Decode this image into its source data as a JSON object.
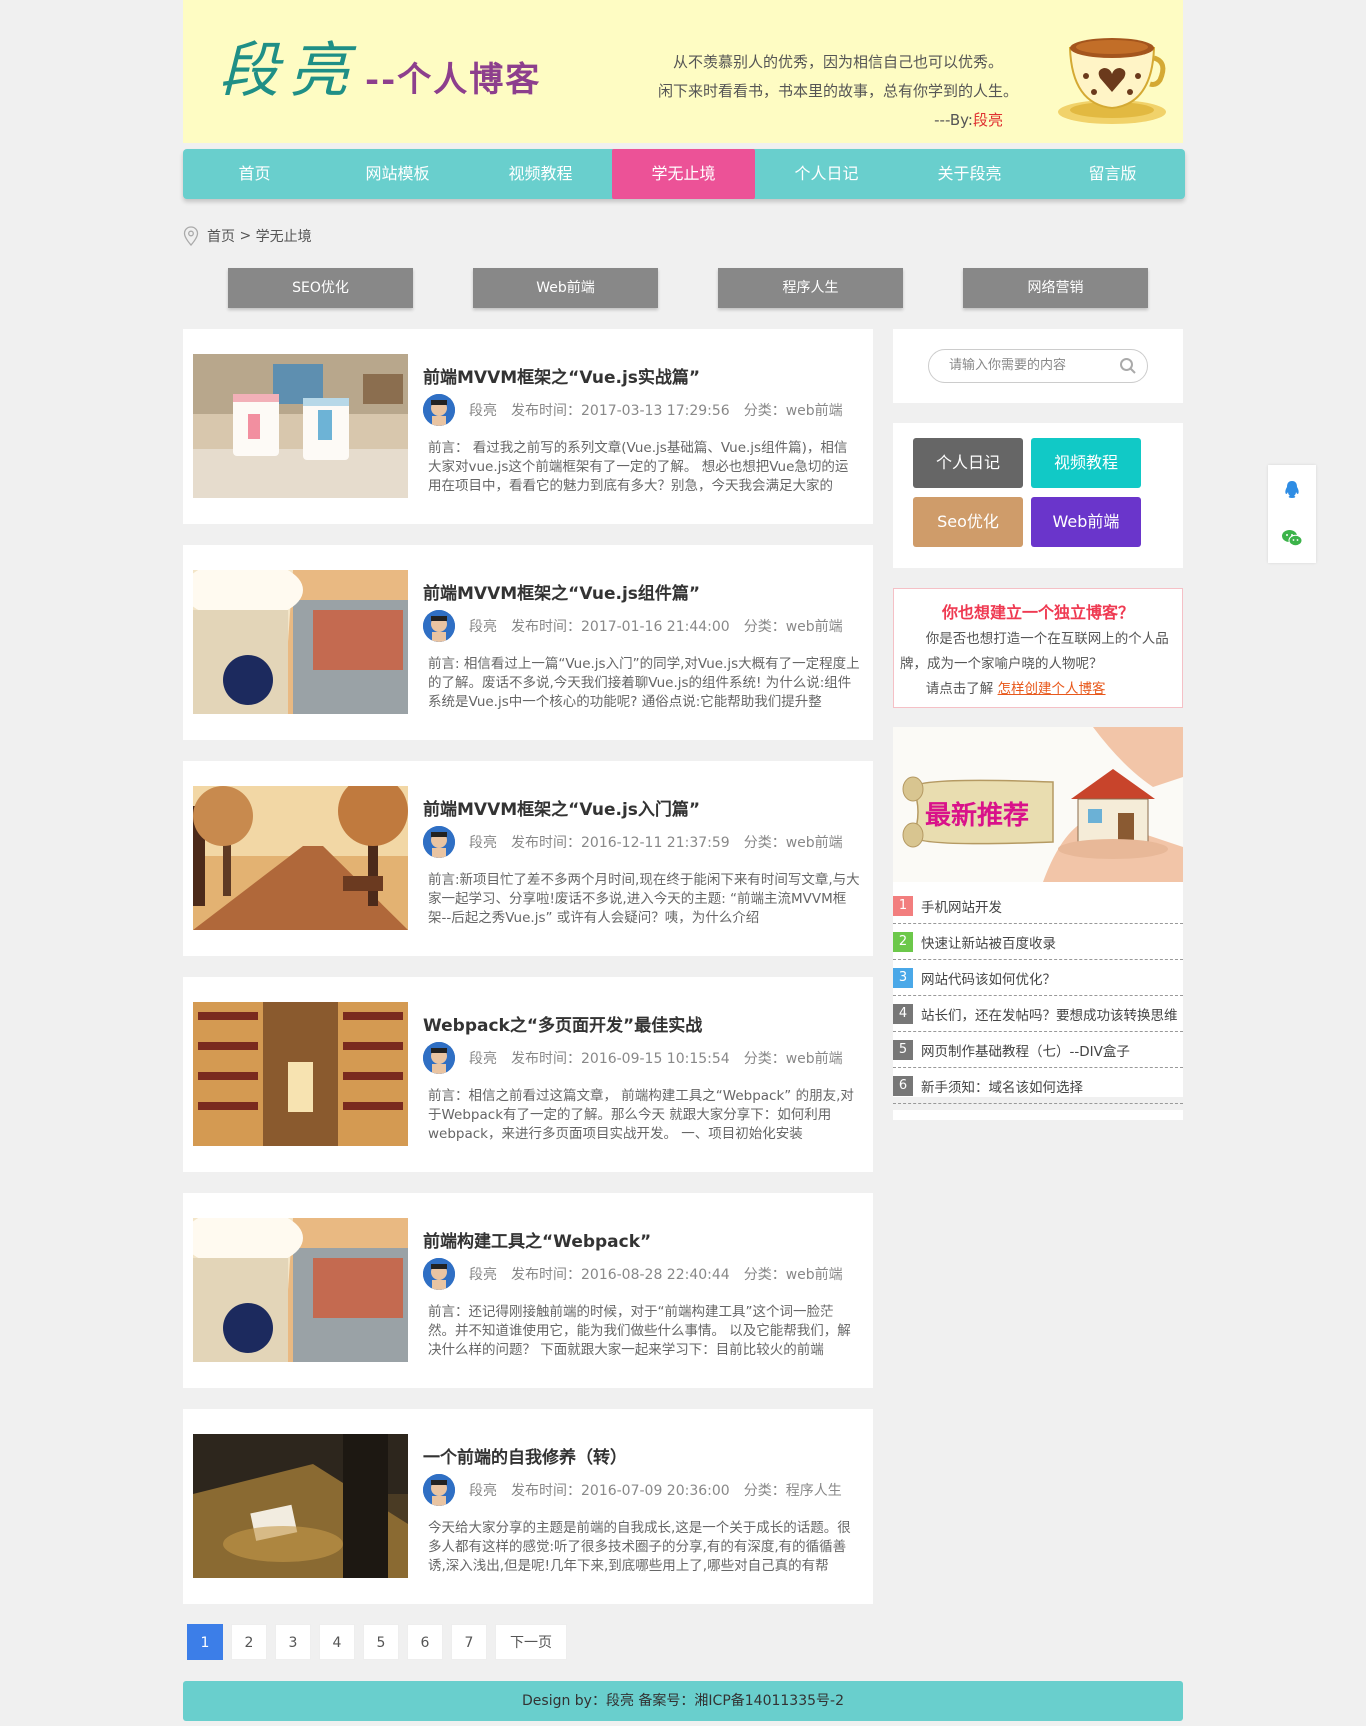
{
  "header": {
    "logo_name": "段亮",
    "logo_sub": "--个人博客",
    "motto_line1": "从不羡慕别人的优秀，因为相信自己也可以优秀。",
    "motto_line2": "闲下来时看看书，书本里的故事，总有你学到的人生。",
    "motto_by": "---By:",
    "motto_author": "段亮"
  },
  "nav": {
    "items": [
      "首页",
      "网站模板",
      "视频教程",
      "学无止境",
      "个人日记",
      "关于段亮",
      "留言版"
    ],
    "active": "学无止境"
  },
  "breadcrumb": {
    "home": "首页",
    "sep": " > ",
    "current": "学无止境"
  },
  "categories": [
    "SEO优化",
    "Web前端",
    "程序人生",
    "网络营销"
  ],
  "posts": [
    {
      "title": "前端MVVM框架之“Vue.js实战篇”",
      "author": "段亮",
      "date_label": "发布时间：",
      "date": "2017-03-13 17:29:56",
      "cat_label": "分类：",
      "cat": "web前端",
      "excerpt": "前言： 看过我之前写的系列文章(Vue.js基础篇、Vue.js组件篇)，相信大家对vue.js这个前端框架有了一定的了解。 想必也想把Vue急切的运用在项目中，看看它的魅力到底有多大？别急，今天我会满足大家的"
    },
    {
      "title": "前端MVVM框架之“Vue.js组件篇”",
      "author": "段亮",
      "date_label": "发布时间：",
      "date": "2017-01-16 21:44:00",
      "cat_label": "分类：",
      "cat": "web前端",
      "excerpt": "前言: 相信看过上一篇“Vue.js入门”的同学,对Vue.js大概有了一定程度上的了解。废话不多说,今天我们接着聊Vue.js的组件系统! 为什么说:组件系统是Vue.js中一个核心的功能呢? 通俗点说:它能帮助我们提升整"
    },
    {
      "title": "前端MVVM框架之“Vue.js入门篇”",
      "author": "段亮",
      "date_label": "发布时间：",
      "date": "2016-12-11 21:37:59",
      "cat_label": "分类：",
      "cat": "web前端",
      "excerpt": "前言:新项目忙了差不多两个月时间,现在终于能闲下来有时间写文章,与大家一起学习、分享啦!废话不多说,进入今天的主题: “前端主流MVVM框架--后起之秀Vue.js” 或许有人会疑问？咦，为什么介绍"
    },
    {
      "title": "Webpack之“多页面开发”最佳实战",
      "author": "段亮",
      "date_label": "发布时间：",
      "date": "2016-09-15 10:15:54",
      "cat_label": "分类：",
      "cat": "web前端",
      "excerpt": "前言：相信之前看过这篇文章， 前端构建工具之“Webpack” 的朋友,对于Webpack有了一定的了解。那么今天 就跟大家分享下：如何利用webpack，来进行多页面项目实战开发。 一、项目初始化安装"
    },
    {
      "title": "前端构建工具之“Webpack”",
      "author": "段亮",
      "date_label": "发布时间：",
      "date": "2016-08-28 22:40:44",
      "cat_label": "分类：",
      "cat": "web前端",
      "excerpt": "前言：还记得刚接触前端的时候，对于“前端构建工具”这个词一脸茫然。并不知道谁使用它，能为我们做些什么事情。 以及它能帮我们，解决什么样的问题？ 下面就跟大家一起来学习下：目前比较火的前端"
    },
    {
      "title": "一个前端的自我修养（转）",
      "author": "段亮",
      "date_label": "发布时间：",
      "date": "2016-07-09 20:36:00",
      "cat_label": "分类：",
      "cat": "程序人生",
      "excerpt": "今天给大家分享的主题是前端的自我成长,这是一个关于成长的话题。很多人都有这样的感觉:听了很多技术圈子的分享,有的有深度,有的循循善诱,深入浅出,但是呢!几年下来,到底哪些用上了,哪些对自己真的有帮"
    }
  ],
  "search": {
    "placeholder": "请输入你需要的内容"
  },
  "tags": [
    {
      "label": "个人日记",
      "color": "#666666"
    },
    {
      "label": "视频教程",
      "color": "#11c9c6"
    },
    {
      "label": "Seo优化",
      "color": "#cf9c6a"
    },
    {
      "label": "Web前端",
      "color": "#6a35cb"
    }
  ],
  "promo": {
    "title": "你也想建立一个独立博客？",
    "text": "你是否也想打造一个在互联网上的个人品牌，成为一个家喻户晓的人物呢？",
    "cta_prefix": "请点击了解",
    "cta_link": "怎样创建个人博客"
  },
  "recommend": {
    "banner_text": "最新推荐",
    "items": [
      {
        "num": "1",
        "color": "#f27e7e",
        "text": "手机网站开发"
      },
      {
        "num": "2",
        "color": "#6cc84a",
        "text": "快速让新站被百度收录"
      },
      {
        "num": "3",
        "color": "#4aa8e8",
        "text": "网站代码该如何优化？"
      },
      {
        "num": "4",
        "color": "#777777",
        "text": "站长们，还在发帖吗？要想成功该转换思维"
      },
      {
        "num": "5",
        "color": "#777777",
        "text": "网页制作基础教程（七）--DIV盒子"
      },
      {
        "num": "6",
        "color": "#777777",
        "text": "新手须知：域名该如何选择"
      }
    ]
  },
  "pager": {
    "pages": [
      "1",
      "2",
      "3",
      "4",
      "5",
      "6",
      "7"
    ],
    "current": "1",
    "next": "下一页"
  },
  "footer": {
    "text": "Design by：段亮  备案号：湘ICP备14011335号-2"
  },
  "colors": {
    "nav": "#69cfcd",
    "nav_active": "#ec5297",
    "header_bg": "#fefcc3"
  }
}
